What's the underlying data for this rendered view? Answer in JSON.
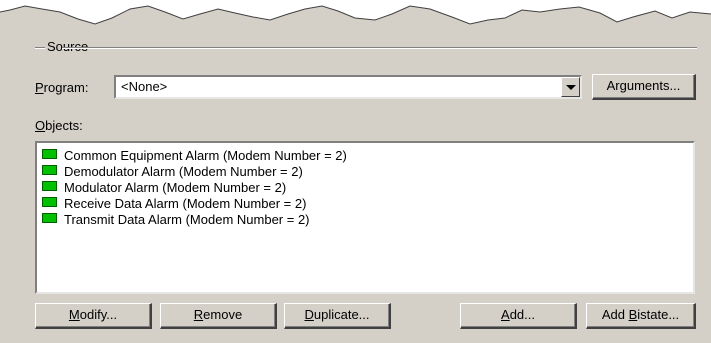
{
  "source_group": {
    "title": "Source"
  },
  "program": {
    "label_underline": "P",
    "label_rest": "rogram:",
    "value": "<None>",
    "arguments_pre": "Ar",
    "arguments_underline": "g",
    "arguments_post": "uments..."
  },
  "objects": {
    "label_underline": "O",
    "label_rest": "bjects:",
    "items": [
      "Common Equipment Alarm (Modem Number = 2)",
      "Demodulator Alarm (Modem Number = 2)",
      "Modulator Alarm (Modem Number = 2)",
      "Receive Data Alarm (Modem Number = 2)",
      "Transmit Data Alarm (Modem Number = 2)"
    ],
    "status_color": "#00c000"
  },
  "buttons": {
    "modify": {
      "u": "M",
      "rest": "odify..."
    },
    "remove": {
      "u": "R",
      "rest": "emove"
    },
    "duplicate": {
      "u": "D",
      "rest": "uplicate..."
    },
    "add": {
      "u": "A",
      "rest": "dd..."
    },
    "add_bistate": {
      "pre": "Add ",
      "u": "B",
      "rest": "istate..."
    }
  },
  "colors": {
    "panel": "#d4d0c8",
    "indicator": "#00c000"
  }
}
